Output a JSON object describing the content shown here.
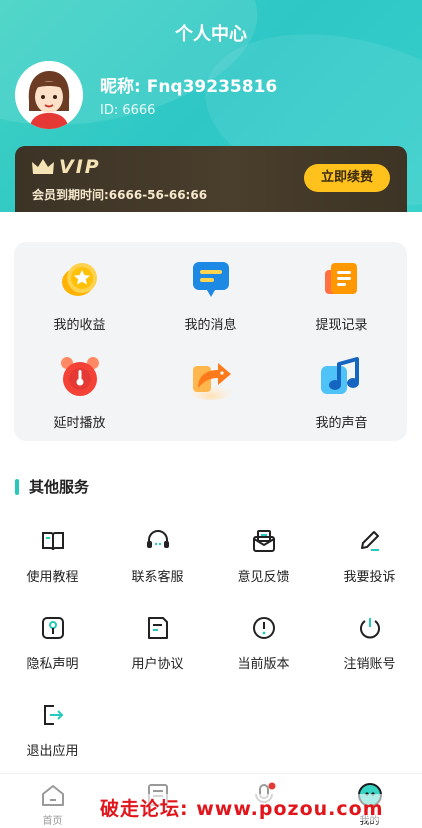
{
  "header": {
    "title": "个人中心",
    "nickname": "昵称: Fnq39235816",
    "user_id": "ID: 6666"
  },
  "vip": {
    "badge": "VIP",
    "expire": "会员到期时间:6666-56-66:66",
    "renew_label": "立即续费"
  },
  "grid": {
    "items": [
      {
        "label": "我的收益",
        "icon": "coin-star-icon"
      },
      {
        "label": "我的消息",
        "icon": "message-icon"
      },
      {
        "label": "提现记录",
        "icon": "record-icon"
      },
      {
        "label": "延时播放",
        "icon": "alarm-clock-icon"
      },
      {
        "label": "",
        "icon": "share-arrow-icon"
      },
      {
        "label": "我的声音",
        "icon": "music-note-icon"
      }
    ]
  },
  "services": {
    "title": "其他服务",
    "items": [
      {
        "label": "使用教程",
        "icon": "book-icon"
      },
      {
        "label": "联系客服",
        "icon": "headset-icon"
      },
      {
        "label": "意见反馈",
        "icon": "feedback-mail-icon"
      },
      {
        "label": "我要投诉",
        "icon": "pencil-icon"
      },
      {
        "label": "隐私声明",
        "icon": "privacy-key-icon"
      },
      {
        "label": "用户协议",
        "icon": "agreement-doc-icon"
      },
      {
        "label": "当前版本",
        "icon": "info-icon"
      },
      {
        "label": "注销账号",
        "icon": "power-icon"
      },
      {
        "label": "退出应用",
        "icon": "logout-icon"
      }
    ]
  },
  "tabbar": {
    "items": [
      {
        "label": "首页",
        "icon": "home-icon"
      },
      {
        "label": "",
        "icon": "list-icon"
      },
      {
        "label": "",
        "icon": "microphone-icon"
      },
      {
        "label": "我的",
        "icon": "profile-face-icon"
      }
    ]
  },
  "watermark": "破走论坛: www.pozou.com",
  "colors": {
    "accent": "#2ec7c6",
    "vip_bg": "#3c3326",
    "renew_button": "#ffc21d"
  }
}
